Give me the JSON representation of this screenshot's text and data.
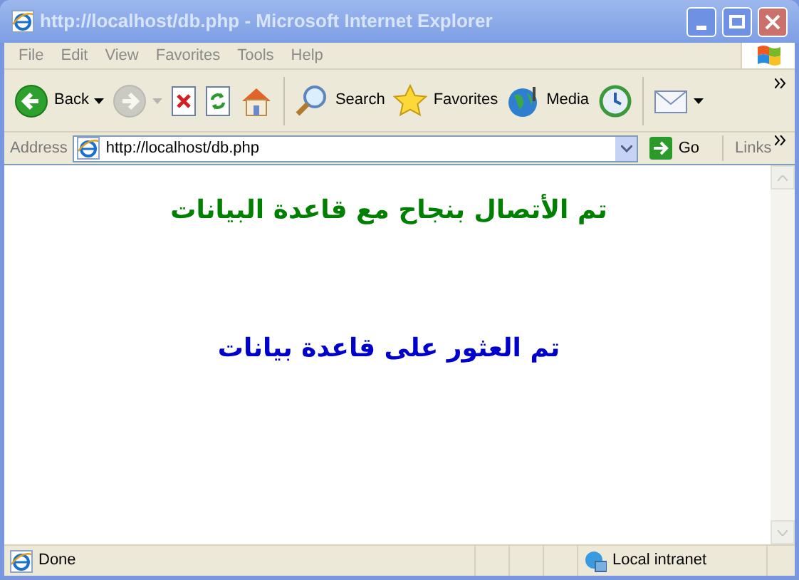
{
  "window": {
    "title": "http://localhost/db.php - Microsoft Internet Explorer",
    "active": false
  },
  "menu": [
    "File",
    "Edit",
    "View",
    "Favorites",
    "Tools",
    "Help"
  ],
  "toolbar": [
    {
      "kind": "back",
      "label": "Back",
      "dropdown": true,
      "disabled": false
    },
    {
      "kind": "forward",
      "dropdown": true,
      "disabled": true
    },
    {
      "kind": "stop",
      "disabled": false
    },
    {
      "kind": "refresh",
      "disabled": false
    },
    {
      "kind": "home",
      "disabled": false
    },
    {
      "kind": "search",
      "label": "Search",
      "disabled": false
    },
    {
      "kind": "favorites",
      "label": "Favorites",
      "disabled": false
    },
    {
      "kind": "media",
      "label": "Media",
      "disabled": false
    },
    {
      "kind": "history",
      "disabled": false
    },
    {
      "kind": "mail",
      "dropdown": true,
      "disabled": false
    }
  ],
  "address_bar": {
    "label": "Address",
    "url": "http://localhost/db.php",
    "go": "Go",
    "links": "Links"
  },
  "messages": [
    {
      "text": "تم الأتصال بنجاح مع قاعدة البيانات",
      "color": "#008000"
    },
    {
      "text": "تم العثور على قاعدة بيانات",
      "color": "#0000cc"
    }
  ],
  "status_bar": {
    "text": "Done",
    "zone": "Local intranet"
  }
}
